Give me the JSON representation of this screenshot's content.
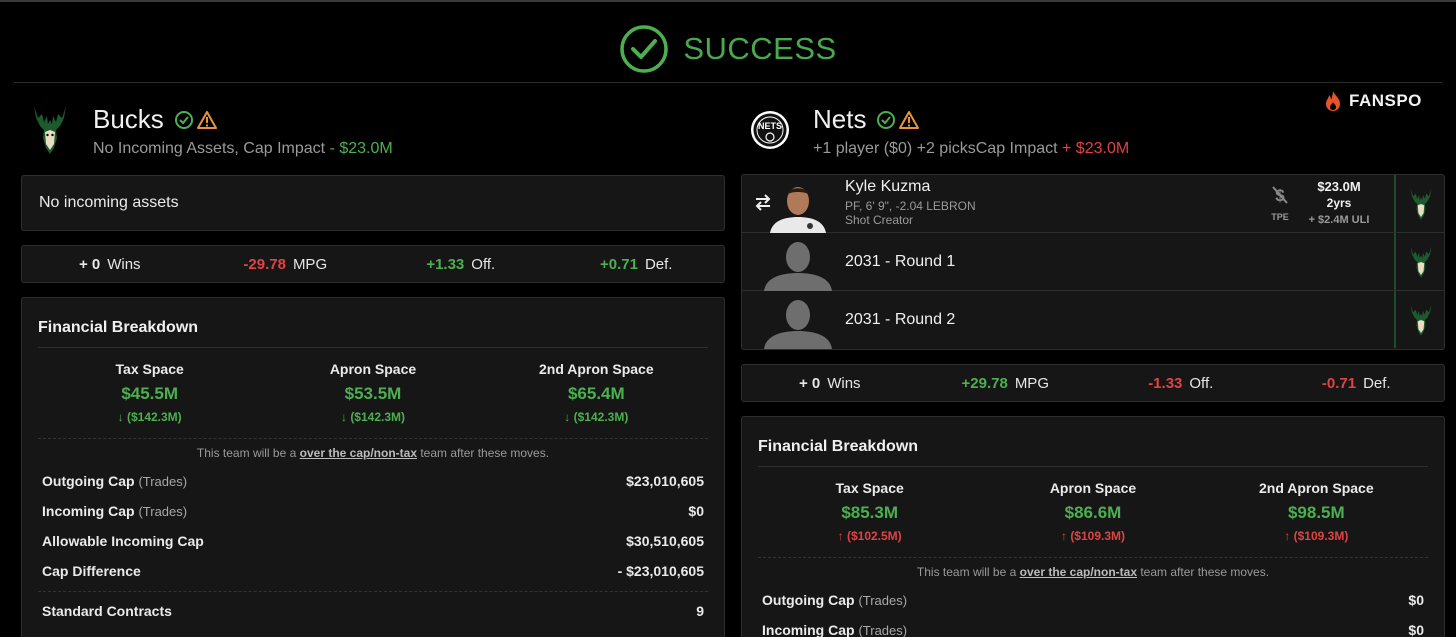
{
  "status": {
    "text": "SUCCESS",
    "icon": "check-circle-icon",
    "color": "#4caf50"
  },
  "brand": {
    "name": "FANSPO",
    "icon": "flame-icon"
  },
  "teams": [
    {
      "name": "Bucks",
      "subtitle": "No Incoming Assets, Cap Impact",
      "cap_impact": "- $23.0M",
      "no_assets_text": "No incoming assets",
      "stats": {
        "wins_value": "+ 0",
        "wins_label": "Wins",
        "mpg_value": "-29.78",
        "mpg_label": "MPG",
        "off_value": "+1.33",
        "off_label": "Off.",
        "def_value": "+0.71",
        "def_label": "Def."
      },
      "financial": {
        "title": "Financial Breakdown",
        "spaces": [
          {
            "label": "Tax Space",
            "value": "$45.5M",
            "change": "($142.3M)"
          },
          {
            "label": "Apron Space",
            "value": "$53.5M",
            "change": "($142.3M)"
          },
          {
            "label": "2nd Apron Space",
            "value": "$65.4M",
            "change": "($142.3M)"
          }
        ],
        "note_pre": "This team will be a",
        "note_link": "over the cap/non-tax",
        "note_post": "team after these moves.",
        "rows": [
          {
            "label": "Outgoing Cap",
            "tag": "(Trades)",
            "value": "$23,010,605"
          },
          {
            "label": "Incoming Cap",
            "tag": "(Trades)",
            "value": "$0"
          },
          {
            "label": "Allowable Incoming Cap",
            "tag": "",
            "value": "$30,510,605"
          },
          {
            "label": "Cap Difference",
            "tag": "",
            "value": "- $23,010,605"
          }
        ],
        "contracts_label": "Standard Contracts",
        "contracts_value": "9"
      }
    },
    {
      "name": "Nets",
      "subtitle": "+1 player ($0) +2 picksCap Impact",
      "cap_impact": "+ $23.0M",
      "assets": [
        {
          "name": "Kyle Kuzma",
          "meta1": "PF, 6' 9\", -2.04 LEBRON",
          "meta2": "Shot Creator",
          "tpe_label": "TPE",
          "salary": "$23.0M",
          "years": "2yrs",
          "uli": "+ $2.4M ULI"
        },
        {
          "name": "2031 - Round 1"
        },
        {
          "name": "2031 - Round 2"
        }
      ],
      "stats": {
        "wins_value": "+ 0",
        "wins_label": "Wins",
        "mpg_value": "+29.78",
        "mpg_label": "MPG",
        "off_value": "-1.33",
        "off_label": "Off.",
        "def_value": "-0.71",
        "def_label": "Def."
      },
      "financial": {
        "title": "Financial Breakdown",
        "spaces": [
          {
            "label": "Tax Space",
            "value": "$85.3M",
            "change": "($102.5M)"
          },
          {
            "label": "Apron Space",
            "value": "$86.6M",
            "change": "($109.3M)"
          },
          {
            "label": "2nd Apron Space",
            "value": "$98.5M",
            "change": "($109.3M)"
          }
        ],
        "note_pre": "This team will be a",
        "note_link": "over the cap/non-tax",
        "note_post": "team after these moves.",
        "rows": [
          {
            "label": "Outgoing Cap",
            "tag": "(Trades)",
            "value": "$0"
          },
          {
            "label": "Incoming Cap",
            "tag": "(Trades)",
            "value": "$0"
          }
        ]
      }
    }
  ]
}
